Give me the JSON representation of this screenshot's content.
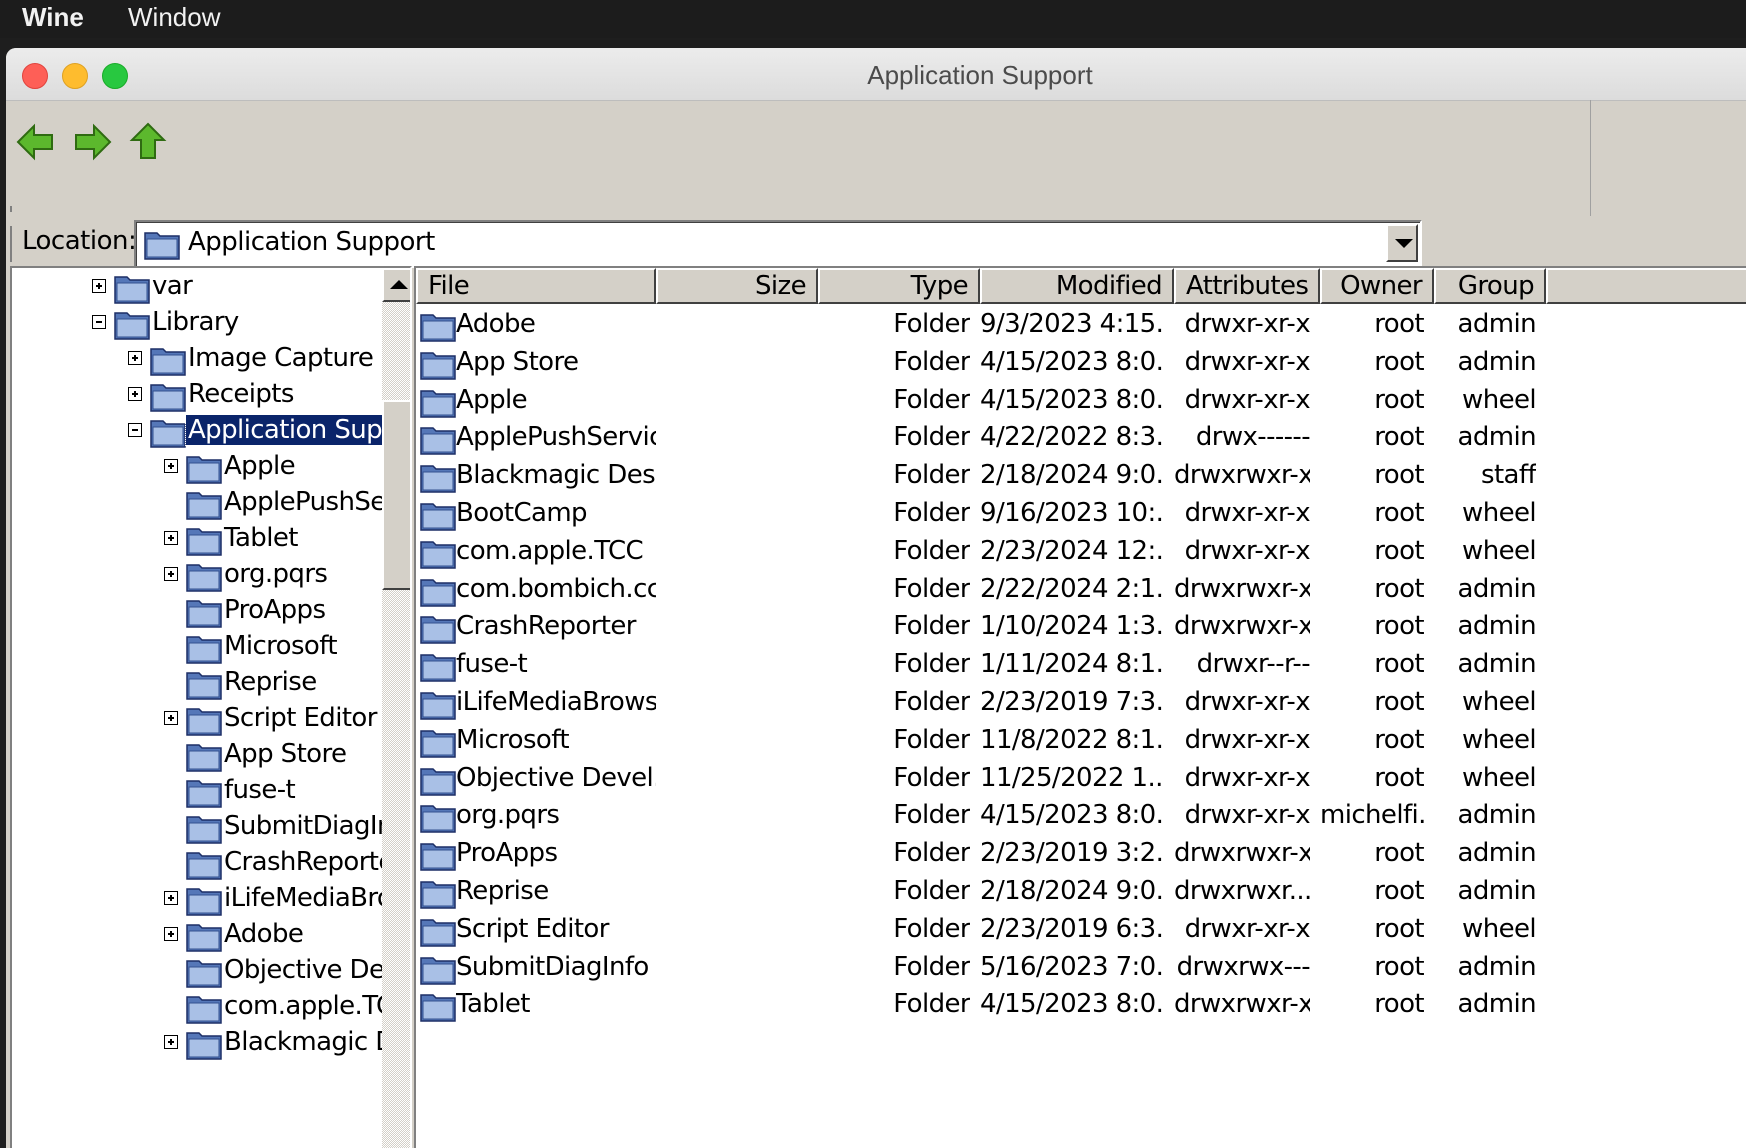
{
  "menubar": {
    "app": "Wine",
    "items": [
      "Window"
    ]
  },
  "window": {
    "title": "Application Support"
  },
  "location": {
    "label": "Location:",
    "value": "Application Support"
  },
  "icons": {
    "back": "back-arrow-icon",
    "forward": "forward-arrow-icon",
    "up": "up-arrow-icon",
    "folder": "folder-icon"
  },
  "colors": {
    "arrow_green": "#5cb82d",
    "selection": "#0a246a",
    "folder_blue": "#5577b8"
  },
  "tree": [
    {
      "label": "var",
      "level": 0,
      "expander": "plus"
    },
    {
      "label": "Library",
      "level": 0,
      "expander": "minus"
    },
    {
      "label": "Image Capture",
      "level": 1,
      "expander": "plus"
    },
    {
      "label": "Receipts",
      "level": 1,
      "expander": "plus"
    },
    {
      "label": "Application Support",
      "level": 1,
      "expander": "minus",
      "selected": true
    },
    {
      "label": "Apple",
      "level": 2,
      "expander": "plus"
    },
    {
      "label": "ApplePushService",
      "level": 2,
      "expander": "none"
    },
    {
      "label": "Tablet",
      "level": 2,
      "expander": "plus"
    },
    {
      "label": "org.pqrs",
      "level": 2,
      "expander": "plus"
    },
    {
      "label": "ProApps",
      "level": 2,
      "expander": "none"
    },
    {
      "label": "Microsoft",
      "level": 2,
      "expander": "none"
    },
    {
      "label": "Reprise",
      "level": 2,
      "expander": "none"
    },
    {
      "label": "Script Editor",
      "level": 2,
      "expander": "plus"
    },
    {
      "label": "App Store",
      "level": 2,
      "expander": "none"
    },
    {
      "label": "fuse-t",
      "level": 2,
      "expander": "none"
    },
    {
      "label": "SubmitDiagInfo",
      "level": 2,
      "expander": "none"
    },
    {
      "label": "CrashReporter",
      "level": 2,
      "expander": "none"
    },
    {
      "label": "iLifeMediaBrowser",
      "level": 2,
      "expander": "plus"
    },
    {
      "label": "Adobe",
      "level": 2,
      "expander": "plus"
    },
    {
      "label": "Objective Development",
      "level": 2,
      "expander": "none"
    },
    {
      "label": "com.apple.TCC",
      "level": 2,
      "expander": "none"
    },
    {
      "label": "Blackmagic Design",
      "level": 2,
      "expander": "plus"
    }
  ],
  "columns": [
    "File",
    "Size",
    "Type",
    "Modified",
    "Attributes",
    "Owner",
    "Group"
  ],
  "files": [
    {
      "name": "Adobe",
      "size": "",
      "type": "Folder",
      "modified": "9/3/2023 4:15...",
      "attributes": "drwxr-xr-x",
      "owner": "root",
      "group": "admin"
    },
    {
      "name": "App Store",
      "size": "",
      "type": "Folder",
      "modified": "4/15/2023 8:0...",
      "attributes": "drwxr-xr-x",
      "owner": "root",
      "group": "admin"
    },
    {
      "name": "Apple",
      "size": "",
      "type": "Folder",
      "modified": "4/15/2023 8:0...",
      "attributes": "drwxr-xr-x",
      "owner": "root",
      "group": "wheel"
    },
    {
      "name": "ApplePushService",
      "size": "",
      "type": "Folder",
      "modified": "4/22/2022 8:3...",
      "attributes": "drwx------",
      "owner": "root",
      "group": "admin"
    },
    {
      "name": "Blackmagic Desi...",
      "size": "",
      "type": "Folder",
      "modified": "2/18/2024 9:0...",
      "attributes": "drwxrwxr-x",
      "owner": "root",
      "group": "staff"
    },
    {
      "name": "BootCamp",
      "size": "",
      "type": "Folder",
      "modified": "9/16/2023 10:...",
      "attributes": "drwxr-xr-x",
      "owner": "root",
      "group": "wheel"
    },
    {
      "name": "com.apple.TCC",
      "size": "",
      "type": "Folder",
      "modified": "2/23/2024 12:...",
      "attributes": "drwxr-xr-x",
      "owner": "root",
      "group": "wheel"
    },
    {
      "name": "com.bombich.ccc",
      "size": "",
      "type": "Folder",
      "modified": "2/22/2024 2:1...",
      "attributes": "drwxrwxr-x",
      "owner": "root",
      "group": "admin"
    },
    {
      "name": "CrashReporter",
      "size": "",
      "type": "Folder",
      "modified": "1/10/2024 1:3...",
      "attributes": "drwxrwxr-x",
      "owner": "root",
      "group": "admin"
    },
    {
      "name": "fuse-t",
      "size": "",
      "type": "Folder",
      "modified": "1/11/2024 8:1...",
      "attributes": "drwxr--r--",
      "owner": "root",
      "group": "admin"
    },
    {
      "name": "iLifeMediaBrowser",
      "size": "",
      "type": "Folder",
      "modified": "2/23/2019 7:3...",
      "attributes": "drwxr-xr-x",
      "owner": "root",
      "group": "wheel"
    },
    {
      "name": "Microsoft",
      "size": "",
      "type": "Folder",
      "modified": "11/8/2022 8:1...",
      "attributes": "drwxr-xr-x",
      "owner": "root",
      "group": "wheel"
    },
    {
      "name": "Objective Devel...",
      "size": "",
      "type": "Folder",
      "modified": "11/25/2022 1...",
      "attributes": "drwxr-xr-x",
      "owner": "root",
      "group": "wheel"
    },
    {
      "name": "org.pqrs",
      "size": "",
      "type": "Folder",
      "modified": "4/15/2023 8:0...",
      "attributes": "drwxr-xr-x",
      "owner": "michelfi...",
      "group": "admin"
    },
    {
      "name": "ProApps",
      "size": "",
      "type": "Folder",
      "modified": "2/23/2019 3:2...",
      "attributes": "drwxrwxr-x",
      "owner": "root",
      "group": "admin"
    },
    {
      "name": "Reprise",
      "size": "",
      "type": "Folder",
      "modified": "2/18/2024 9:0...",
      "attributes": "drwxrwxr...",
      "owner": "root",
      "group": "admin"
    },
    {
      "name": "Script Editor",
      "size": "",
      "type": "Folder",
      "modified": "2/23/2019 6:3...",
      "attributes": "drwxr-xr-x",
      "owner": "root",
      "group": "wheel"
    },
    {
      "name": "SubmitDiagInfo",
      "size": "",
      "type": "Folder",
      "modified": "5/16/2023 7:0...",
      "attributes": "drwxrwx---",
      "owner": "root",
      "group": "admin"
    },
    {
      "name": "Tablet",
      "size": "",
      "type": "Folder",
      "modified": "4/15/2023 8:0...",
      "attributes": "drwxrwxr-x",
      "owner": "root",
      "group": "admin"
    }
  ]
}
